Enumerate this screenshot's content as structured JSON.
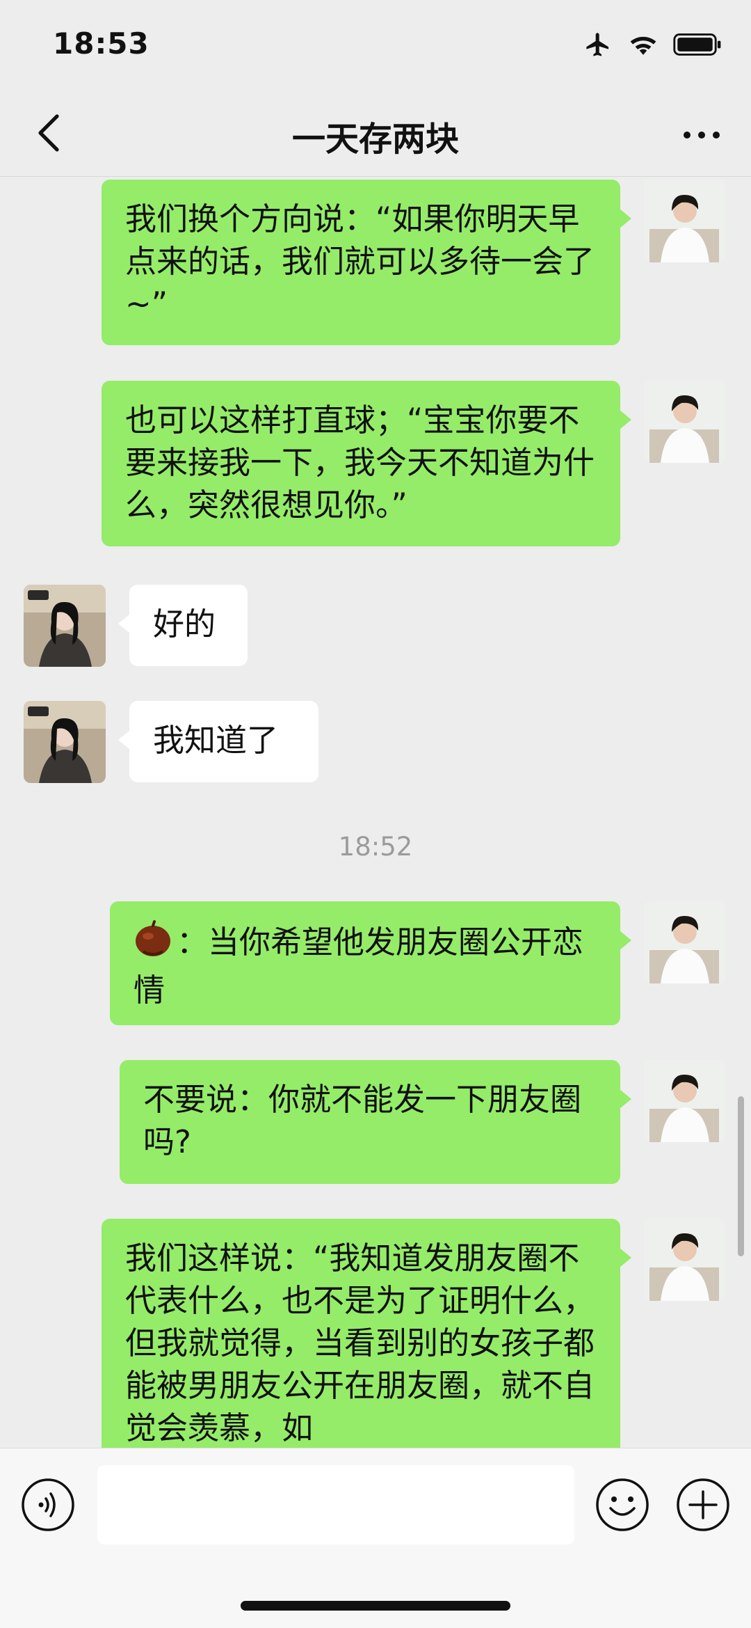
{
  "status_bar": {
    "time": "18:53",
    "icons": [
      "airplane-icon",
      "wifi-icon",
      "battery-icon"
    ]
  },
  "nav": {
    "title": "一天存两块",
    "back_icon": "chevron-left-icon",
    "more_icon": "more-dots-icon"
  },
  "messages": [
    {
      "sender": "self",
      "text": "我们换个方向说：“如果你明天早点来的话，我们就可以多待一会了~”"
    },
    {
      "sender": "self",
      "text": "也可以这样打直球；“宝宝你要不要来接我一下，我今天不知道为什么，突然很想见你。”"
    },
    {
      "sender": "other",
      "text": "好的"
    },
    {
      "sender": "other",
      "text": "我知道了"
    },
    {
      "type": "timestamp",
      "text": "18:52"
    },
    {
      "sender": "self",
      "emoji": "chestnut-icon",
      "text": "：当你希望他发朋友圈公开恋情"
    },
    {
      "sender": "self",
      "text": "不要说：你就不能发一下朋友圈吗?"
    },
    {
      "sender": "self",
      "text": "我们这样说：“我知道发朋友圈不代表什么，也不是为了证明什么，但我就觉得，当看到别的女孩子都能被男朋友公开在朋友圈，就不自觉会羡慕，如"
    }
  ],
  "input_bar": {
    "placeholder": "",
    "icons": [
      "voice-icon",
      "emoji-icon",
      "plus-icon"
    ]
  },
  "colors": {
    "background": "#ededed",
    "self_bubble": "#95ec69",
    "other_bubble": "#ffffff",
    "timestamp": "#9b9b9b"
  }
}
